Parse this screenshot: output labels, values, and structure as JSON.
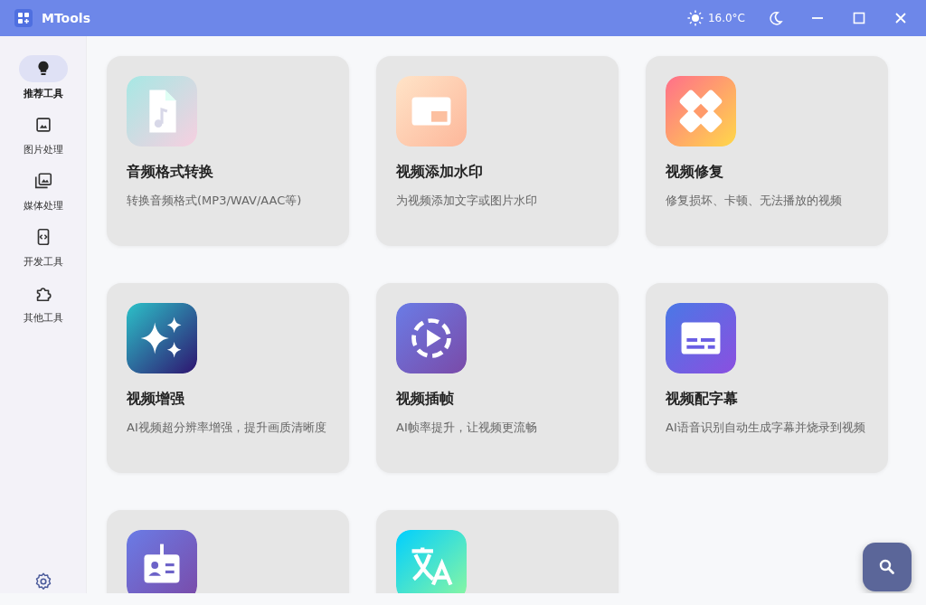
{
  "window": {
    "title": "MTools",
    "temperature": "16.0°C"
  },
  "sidebar": {
    "items": [
      {
        "kind": "bulb",
        "label": "推荐工具",
        "selected": true
      },
      {
        "kind": "image",
        "label": "图片处理",
        "selected": false
      },
      {
        "kind": "media",
        "label": "媒体处理",
        "selected": false
      },
      {
        "kind": "code",
        "label": "开发工具",
        "selected": false
      },
      {
        "kind": "puzzle",
        "label": "其他工具",
        "selected": false
      }
    ]
  },
  "tools": [
    {
      "kind": "audio",
      "title": "音频格式转换",
      "description": "转换音频格式(MP3/WAV/AAC等)"
    },
    {
      "kind": "watermark",
      "title": "视频添加水印",
      "description": "为视频添加文字或图片水印"
    },
    {
      "kind": "repair",
      "title": "视频修复",
      "description": "修复损坏、卡顿、无法播放的视频"
    },
    {
      "kind": "enhance",
      "title": "视频增强",
      "description": "AI视频超分辨率增强，提升画质清晰度"
    },
    {
      "kind": "interpolate",
      "title": "视频插帧",
      "description": "AI帧率提升，让视频更流畅"
    },
    {
      "kind": "subtitle",
      "title": "视频配字幕",
      "description": "AI语音识别自动生成字幕并烧录到视频"
    },
    {
      "kind": "badge"
    },
    {
      "kind": "translate"
    }
  ]
}
